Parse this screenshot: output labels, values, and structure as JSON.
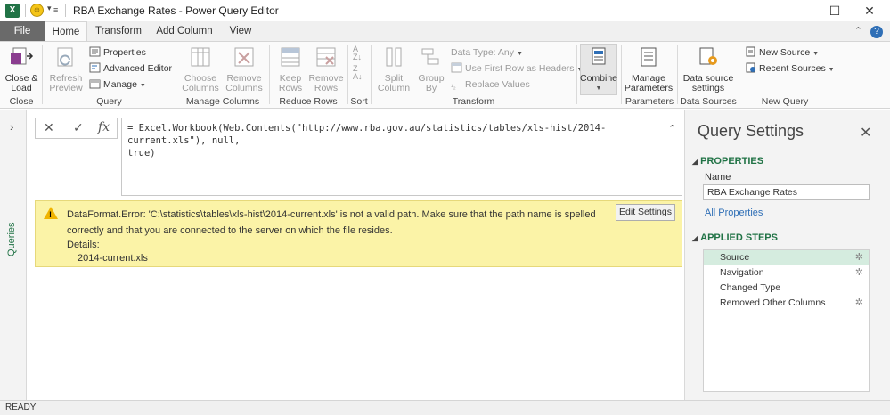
{
  "window": {
    "title": "RBA Exchange Rates - Power Query Editor",
    "app_icon": "X",
    "minimize": "—",
    "maximize": "☐",
    "close": "✕"
  },
  "tabs": [
    "File",
    "Home",
    "Transform",
    "Add Column",
    "View"
  ],
  "active_tab": "Home",
  "ribbon": {
    "close_load": "Close &\nLoad",
    "refresh_preview": "Refresh\nPreview",
    "properties": "Properties",
    "advanced_editor": "Advanced Editor",
    "manage": "Manage",
    "choose_columns": "Choose\nColumns",
    "remove_columns": "Remove\nColumns",
    "keep_rows": "Keep\nRows",
    "remove_rows": "Remove\nRows",
    "split_column": "Split\nColumn",
    "group_by": "Group\nBy",
    "data_type": "Data Type: Any",
    "use_first_row": "Use First Row as Headers",
    "replace_values": "Replace Values",
    "combine": "Combine",
    "manage_parameters": "Manage\nParameters",
    "data_source_settings": "Data source\nsettings",
    "new_source": "New Source",
    "recent_sources": "Recent Sources",
    "groups": {
      "close": "Close",
      "query": "Query",
      "manage_columns": "Manage Columns",
      "reduce_rows": "Reduce Rows",
      "sort": "Sort",
      "transform": "Transform",
      "parameters": "Parameters",
      "data_sources": "Data Sources",
      "new_query": "New Query"
    }
  },
  "rail": {
    "label": "Queries"
  },
  "formula": {
    "cancel": "✕",
    "commit": "✓",
    "fx": "fx",
    "text": "= Excel.Workbook(Web.Contents(\"http://www.rba.gov.au/statistics/tables/xls-hist/2014-current.xls\"), null,\ntrue)"
  },
  "error": {
    "message": "DataFormat.Error: 'C:\\statistics\\tables\\xls-hist\\2014-current.xls' is not a valid path. Make sure that the path name is spelled correctly and that you are connected to the server on which the file resides.",
    "details_label": "Details:",
    "details_value": "2014-current.xls",
    "edit_button": "Edit Settings"
  },
  "query_settings": {
    "title": "Query Settings",
    "properties_header": "PROPERTIES",
    "name_label": "Name",
    "name_value": "RBA Exchange Rates",
    "all_properties": "All Properties",
    "applied_steps_header": "APPLIED STEPS",
    "steps": [
      "Source",
      "Navigation",
      "Changed Type",
      "Removed Other Columns"
    ],
    "selected_step": "Source"
  },
  "status": {
    "text": "READY"
  },
  "colors": {
    "accent": "#217346",
    "error_bg": "#fbf3a7",
    "selected_step": "#d5ecdf"
  }
}
